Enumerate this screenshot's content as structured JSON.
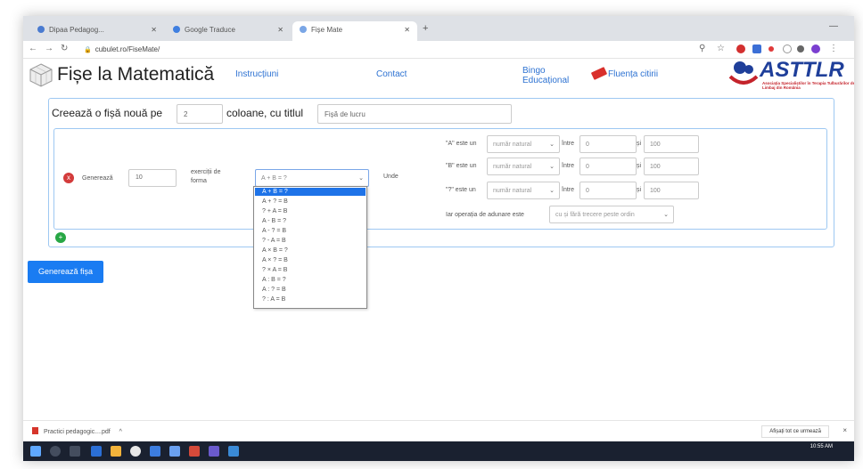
{
  "browser": {
    "tabs": [
      {
        "label": "Dipaa Pedagog..."
      },
      {
        "label": "Google Traduce"
      },
      {
        "label": "Fișe Mate"
      }
    ],
    "new_tab": "+",
    "url": "cubulet.ro/FiseMate/"
  },
  "header": {
    "site_title": "Fișe la Matematică",
    "nav": {
      "instructiuni": "Instrucțiuni",
      "contact": "Contact",
      "bingo_line1": "Bingo",
      "bingo_line2": "Educațional",
      "fluenta": "Fluența citirii"
    },
    "partner_logo": "ASTTLR",
    "partner_sub": "Asociația Specialiștilor în Terapia Tulburărilor de Limbaj din România"
  },
  "form": {
    "create_prefix": "Creează o fișă nouă pe",
    "columns_value": "2",
    "columns_suffix": "coloane, cu titlul",
    "title_value": "Fișă de lucru"
  },
  "exercise": {
    "remove_icon": "x",
    "generate_label": "Generează",
    "count_value": "10",
    "form_label": "exerciții de forma",
    "form_selected": "A + B = ?",
    "unde_label": "Unde",
    "vars": [
      {
        "label": "\"A\" este un",
        "type": "număr natural",
        "intre": "între",
        "from": "0",
        "si": "și",
        "to": "100"
      },
      {
        "label": "\"B\" este un",
        "type": "număr natural",
        "intre": "între",
        "from": "0",
        "si": "și",
        "to": "100"
      },
      {
        "label": "\"?\" este un",
        "type": "număr natural",
        "intre": "între",
        "from": "0",
        "si": "și",
        "to": "100"
      }
    ],
    "operation_label": "Iar operația de adunare este",
    "operation_value": "cu și fără trecere peste ordin",
    "add_icon": "+"
  },
  "dropdown_options": [
    "A + B = ?",
    "A + ? = B",
    "? + A = B",
    "A - B = ?",
    "A - ? = B",
    "? - A = B",
    "A × B = ?",
    "A × ? = B",
    "? × A = B",
    "A : B = ?",
    "A : ? = B",
    "? : A = B"
  ],
  "generate_sheet_button": "Generează fișa",
  "downloads": {
    "file": "Practici pedagogic....pdf",
    "chevron": "^",
    "show_all": "Afișați tot ce urmează",
    "close": "×"
  },
  "taskbar": {
    "time": "10:55 AM"
  },
  "colors": {
    "link": "#2d72d2",
    "primary_button": "#1a7cf2",
    "remove": "#d33b3b",
    "add": "#28a745",
    "dropdown_selected": "#1e73e8",
    "brand": "#1f3f9a"
  }
}
